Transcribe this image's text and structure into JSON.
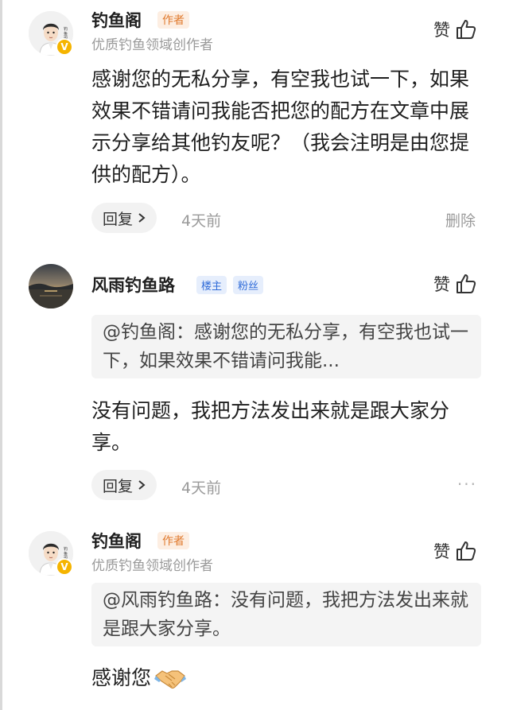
{
  "comments": [
    {
      "author": "钓鱼阁",
      "author_tag": "作者",
      "subtitle": "优质钓鱼领域创作者",
      "avatar_badge": "V",
      "like_label": "赞",
      "text": "感谢您的无私分享，有空我也试一下，如果效果不错请问我能否把您的配方在文章中展示分享给其他钓友呢？（我会注明是由您提供的配方）。",
      "reply_label": "回复",
      "time": "4天前",
      "action_label": "删除"
    },
    {
      "author": "风雨钓鱼路",
      "tags": [
        "楼主",
        "粉丝"
      ],
      "like_label": "赞",
      "quote": "@钓鱼阁：感谢您的无私分享，有空我也试一下，如果效果不错请问我能...",
      "text": "没有问题，我把方法发出来就是跟大家分享。",
      "reply_label": "回复",
      "time": "4天前",
      "more": "···"
    },
    {
      "author": "钓鱼阁",
      "author_tag": "作者",
      "subtitle": "优质钓鱼领域创作者",
      "avatar_badge": "V",
      "like_label": "赞",
      "quote": "@风雨钓鱼路：没有问题，我把方法发出来就是跟大家分享。",
      "text": "感谢您",
      "emoji": "handshake"
    }
  ],
  "icons": {
    "like": "thumbs-up-icon",
    "chevron": "chevron-right-icon",
    "emoji": "handshake-emoji-icon"
  },
  "colors": {
    "author_tag": "#e07a2e",
    "blue_tag": "#2f6bd8",
    "verified": "#f5b400",
    "muted": "#9a9a9a"
  }
}
